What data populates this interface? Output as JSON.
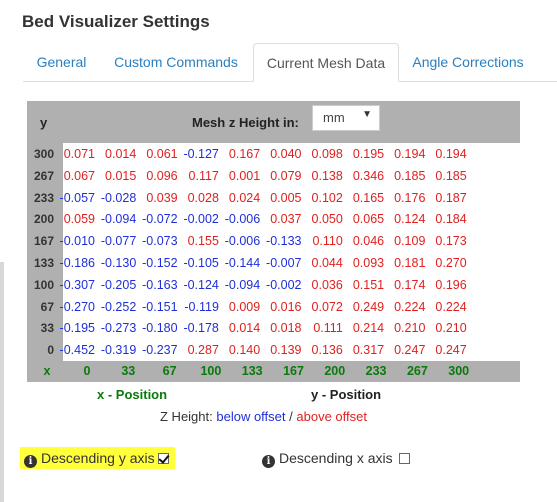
{
  "title": "Bed Visualizer Settings",
  "tabs": [
    {
      "label": "General",
      "active": false
    },
    {
      "label": "Custom Commands",
      "active": false
    },
    {
      "label": "Current Mesh Data",
      "active": true
    },
    {
      "label": "Angle Corrections",
      "active": false
    }
  ],
  "mesh": {
    "y_header": "y",
    "height_label": "Mesh z Height in:",
    "unit": "mm",
    "y_values": [
      "300",
      "267",
      "233",
      "200",
      "167",
      "133",
      "100",
      "67",
      "33",
      "0"
    ],
    "x_label": "x",
    "x_values": [
      "0",
      "33",
      "67",
      "100",
      "133",
      "167",
      "200",
      "233",
      "267",
      "300"
    ],
    "rows": [
      [
        "0.071",
        "0.014",
        "0.061",
        "-0.127",
        "0.167",
        "0.040",
        "0.098",
        "0.195",
        "0.194",
        "0.194"
      ],
      [
        "0.067",
        "0.015",
        "0.096",
        "0.117",
        "0.001",
        "0.079",
        "0.138",
        "0.346",
        "0.185",
        "0.185"
      ],
      [
        "-0.057",
        "-0.028",
        "0.039",
        "0.028",
        "0.024",
        "0.005",
        "0.102",
        "0.165",
        "0.176",
        "0.187"
      ],
      [
        "0.059",
        "-0.094",
        "-0.072",
        "-0.002",
        "-0.006",
        "0.037",
        "0.050",
        "0.065",
        "0.124",
        "0.184"
      ],
      [
        "-0.010",
        "-0.077",
        "-0.073",
        "0.155",
        "-0.006",
        "-0.133",
        "0.110",
        "0.046",
        "0.109",
        "0.173"
      ],
      [
        "-0.186",
        "-0.130",
        "-0.152",
        "-0.105",
        "-0.144",
        "-0.007",
        "0.044",
        "0.093",
        "0.181",
        "0.270"
      ],
      [
        "-0.307",
        "-0.205",
        "-0.163",
        "-0.124",
        "-0.094",
        "-0.002",
        "0.036",
        "0.151",
        "0.174",
        "0.196"
      ],
      [
        "-0.270",
        "-0.252",
        "-0.151",
        "-0.119",
        "0.009",
        "0.016",
        "0.072",
        "0.249",
        "0.224",
        "0.224"
      ],
      [
        "-0.195",
        "-0.273",
        "-0.180",
        "-0.178",
        "0.014",
        "0.018",
        "0.111",
        "0.214",
        "0.210",
        "0.210"
      ],
      [
        "-0.452",
        "-0.319",
        "-0.237",
        "0.287",
        "0.140",
        "0.139",
        "0.136",
        "0.317",
        "0.247",
        "0.247"
      ]
    ]
  },
  "captions": {
    "x_position": "x - Position",
    "y_position": "y - Position"
  },
  "legend": {
    "prefix": "Z Height:",
    "below": "below offset",
    "sep": "/",
    "above": "above offset"
  },
  "colors": {
    "negative": "#1f2fd8",
    "positive": "#e02020",
    "x_axis": "#0a7a0a",
    "highlight": "#ffff3a"
  },
  "options": {
    "descending_y": {
      "label": "Descending y axis",
      "checked": true
    },
    "descending_x": {
      "label": "Descending x axis",
      "checked": false
    }
  }
}
